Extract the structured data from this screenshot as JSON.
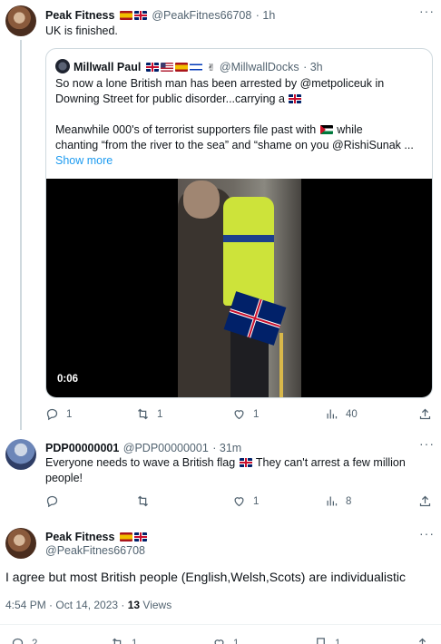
{
  "tweet1": {
    "name": "Peak Fitness",
    "handle": "@PeakFitnes66708",
    "time": "· 1h",
    "text": "UK is finished."
  },
  "quote": {
    "name": "Millwall Paul",
    "handle": "@MillwallDocks",
    "time": "· 3h",
    "line1": "So now a lone British man has been arrested by @metpoliceuk in",
    "line2": "Downing Street for public disorder...carrying a",
    "line3": "Meanwhile 000's of terrorist supporters file past with",
    "line3b": "while",
    "line4": "chanting “from the river to the sea” and “shame on you @RishiSunak ...",
    "show_more": "Show more",
    "video_time": "0:06"
  },
  "tweet1_actions": {
    "replies": "1",
    "retweets": "1",
    "likes": "1",
    "views": "40"
  },
  "reply": {
    "name": "PDP00000001",
    "handle": "@PDP00000001",
    "time": "· 31m",
    "line1a": "Everyone needs to wave a British flag",
    "line1b": "They can't arrest a few million",
    "line2": "people!",
    "likes": "1",
    "views": "8"
  },
  "main": {
    "name": "Peak Fitness",
    "handle": "@PeakFitnes66708",
    "text": "I agree but most British people (English,Welsh,Scots) are individualistic",
    "time": "4:54 PM · Oct 14, 2023 · ",
    "views_count": "13",
    "views_label": " Views"
  },
  "bottom_actions": {
    "replies": "2",
    "retweets": "1",
    "likes": "1",
    "bookmarks": "1"
  },
  "colors": {
    "accent": "#1d9bf0",
    "muted": "#536471",
    "border": "#cfd9de"
  }
}
